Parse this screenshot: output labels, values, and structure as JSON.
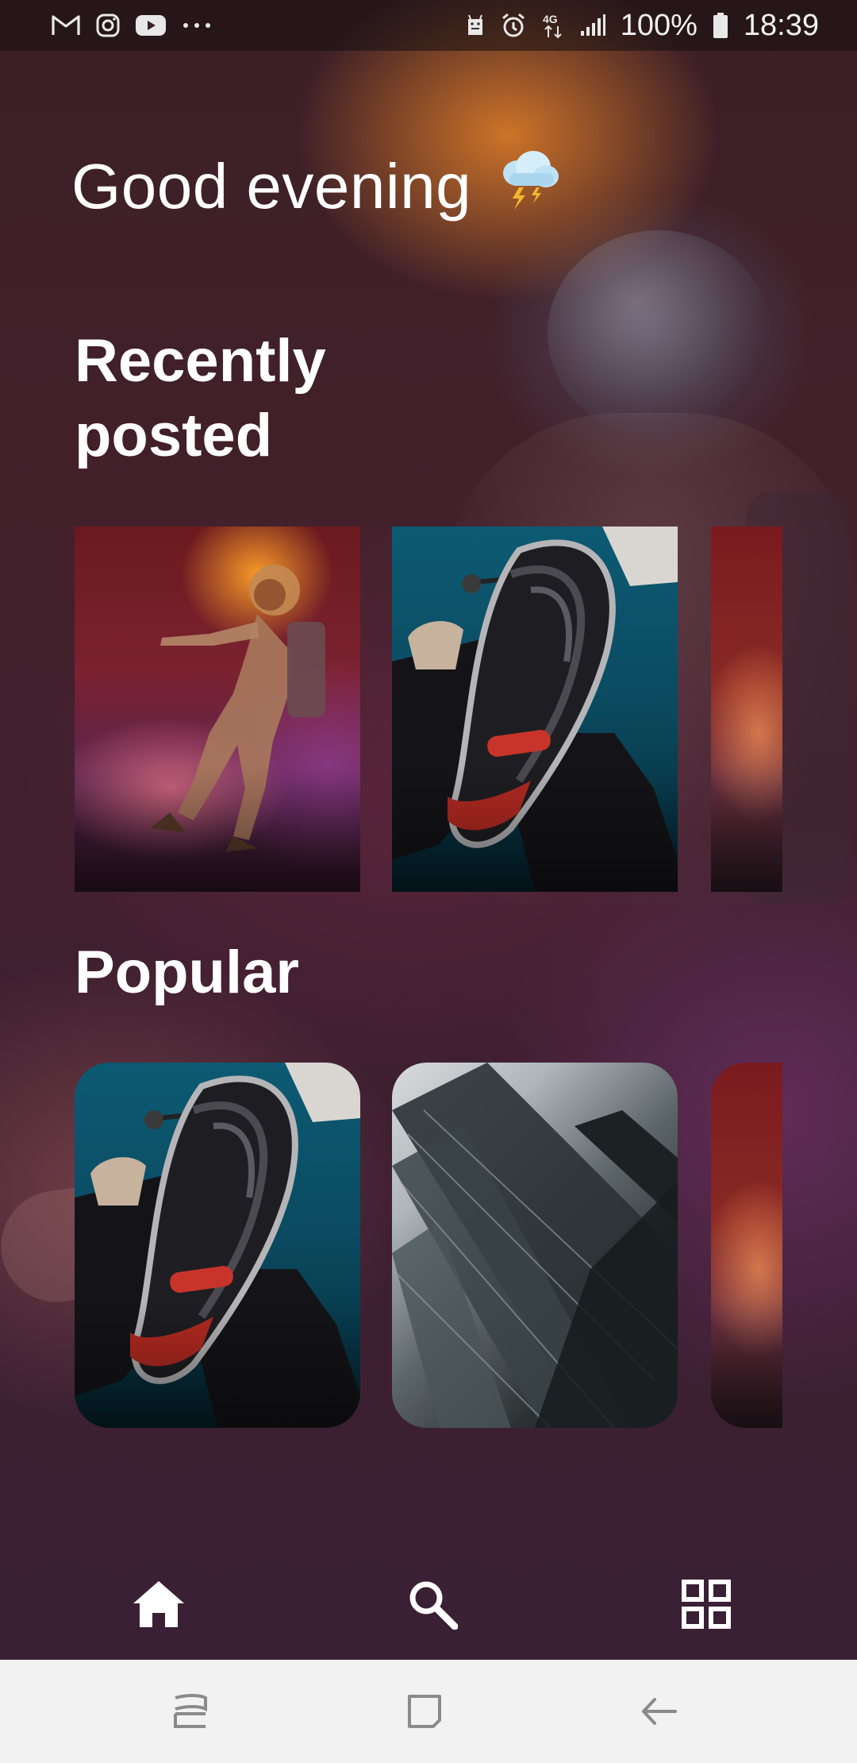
{
  "status_bar": {
    "left_icons": [
      "gmail-icon",
      "instagram-icon",
      "youtube-icon",
      "more-notifications-icon"
    ],
    "right_icons": [
      "android-icon",
      "alarm-icon",
      "4g-data-icon",
      "signal-icon",
      "battery-icon"
    ],
    "battery_text": "100%",
    "time": "18:39"
  },
  "header": {
    "greeting": "Good evening",
    "weather_icon": "thunderstorm-cloud-icon"
  },
  "sections": {
    "recent": {
      "title": "Recently posted",
      "cards": [
        {
          "image": "astronaut-in-smoke-photo"
        },
        {
          "image": "sneaker-sole-jump-photo"
        },
        {
          "image": "astronaut-partial-photo"
        }
      ]
    },
    "popular": {
      "title": "Popular",
      "cards": [
        {
          "image": "sneaker-sole-jump-photo"
        },
        {
          "image": "building-facade-photo"
        },
        {
          "image": "astronaut-partial-photo"
        }
      ]
    }
  },
  "bottom_nav": {
    "items": [
      {
        "icon": "home-icon",
        "active": true
      },
      {
        "icon": "search-icon",
        "active": false
      },
      {
        "icon": "grid-icon",
        "active": false
      }
    ]
  },
  "system_nav": {
    "items": [
      "recent-apps-icon",
      "home-square-icon",
      "back-icon"
    ]
  },
  "colors": {
    "text": "#ffffff",
    "system_nav_bg": "#f2f2f2",
    "orange_smoke": "#e6822a"
  }
}
